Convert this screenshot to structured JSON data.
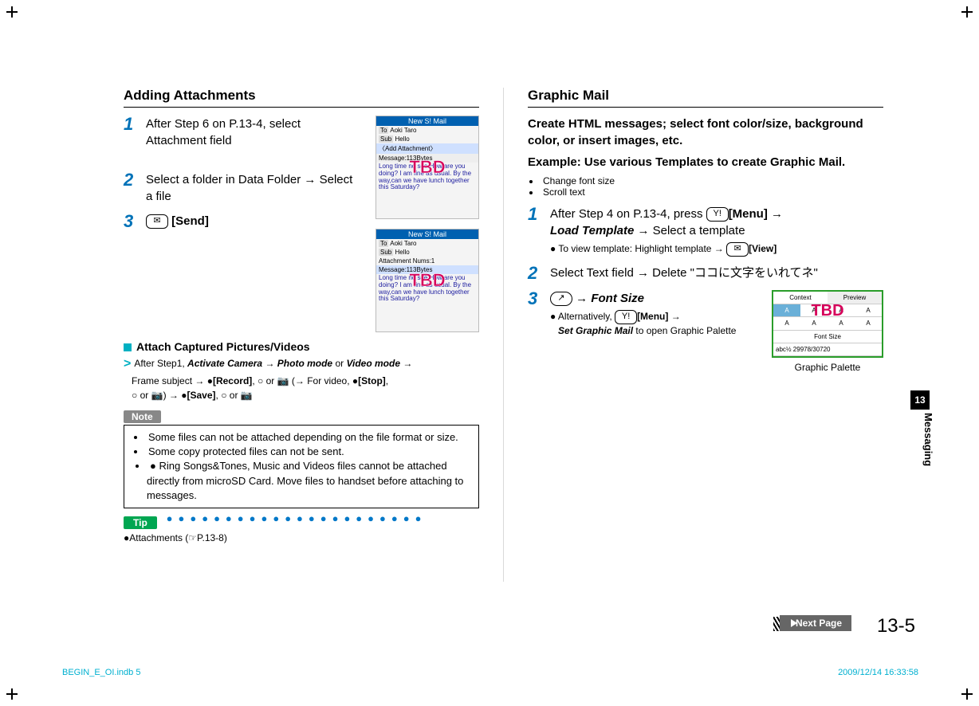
{
  "left": {
    "heading": "Adding Attachments",
    "steps": [
      {
        "num": "1",
        "text": "After Step 6 on P.13-4, select Attachment field"
      },
      {
        "num": "2",
        "text": "Select a folder in Data Folder → Select a file"
      },
      {
        "num": "3",
        "key_icon": "✉",
        "label": "[Send]"
      }
    ],
    "shot1": {
      "title": "New S! Mail",
      "to": "Aoki Taro",
      "sub": "Hello",
      "attach": "〈Add Attachment〉",
      "msg": "Message:113Bytes",
      "body": "Long time no see.How are you doing? I am fine as usual. By the way,can we have lunch together this Saturday?",
      "tbd": "TBD"
    },
    "shot2": {
      "title": "New S! Mail",
      "to": "Aoki Taro",
      "sub": "Hello",
      "attach": "Attachment Nums:1",
      "msg": "Message:113Bytes",
      "body": "Long time no see.How are you doing? I am fine as usual. By the way,can we have lunch together this Saturday?",
      "tbd": "TBD"
    },
    "sub_heading": "Attach Captured Pictures/Videos",
    "chevron_text_1": "After Step1, ",
    "chevron_bold_1a": "Activate Camera",
    "chevron_sep": " → ",
    "chevron_bold_1b": "Photo mode",
    "chevron_text_2": " or ",
    "chevron_bold_1c": "Video mode",
    "chevron_line2_a": "Frame subject → ",
    "key_record": "[Record]",
    "chevron_line2_b": ",  or  (→ For video, ",
    "key_stop": "[Stop]",
    "chevron_line2_c": ",  or ) → ",
    "key_save": "[Save]",
    "chevron_line2_d": ",  or ",
    "note_label": "Note",
    "notes": [
      "Some files can not be attached depending on the file format or size.",
      "Some copy protected files can not be sent.",
      "Ring Songs&Tones, Music and Videos files cannot be attached directly from microSD Card. Move files to handset before attaching to messages."
    ],
    "tip_label": "Tip",
    "tip_text": "●Attachments (☞P.13-8)"
  },
  "right": {
    "heading": "Graphic Mail",
    "intro1": "Create HTML messages; select font color/size, background color, or insert images, etc.",
    "intro2": "Example: Use various Templates to create Graphic Mail.",
    "bullets": [
      "Change font size",
      "Scroll text"
    ],
    "step1_a": "After Step 4 on P.13-4, press ",
    "step1_menu": "[Menu]",
    "step1_b": " → ",
    "step1_load": "Load Template",
    "step1_c": " → Select a template",
    "step1_sub_a": "To view template: Highlight template → ",
    "step1_view": "[View]",
    "step2_a": "Select Text field → Delete \"",
    "step2_jp": "ココに文字をいれてネ",
    "step2_b": "\"",
    "step3_a": " → ",
    "step3_font": "Font Size",
    "step3_sub_a": "Alternatively, ",
    "step3_menu": "[Menu]",
    "step3_sub_b": " → ",
    "step3_set": "Set Graphic Mail",
    "step3_sub_c": " to open Graphic Palette",
    "palette": {
      "context": "Context",
      "preview": "Preview",
      "label": "Font Size",
      "bottom": "abc½    29978/30720",
      "caption": "Graphic Palette",
      "tbd": "TBD"
    }
  },
  "side": {
    "chapter": "13",
    "label": "Messaging"
  },
  "page_num": "13-5",
  "next_page": "Next Page",
  "footer_left": "BEGIN_E_OI.indb   5",
  "footer_right": "2009/12/14   16:33:58"
}
